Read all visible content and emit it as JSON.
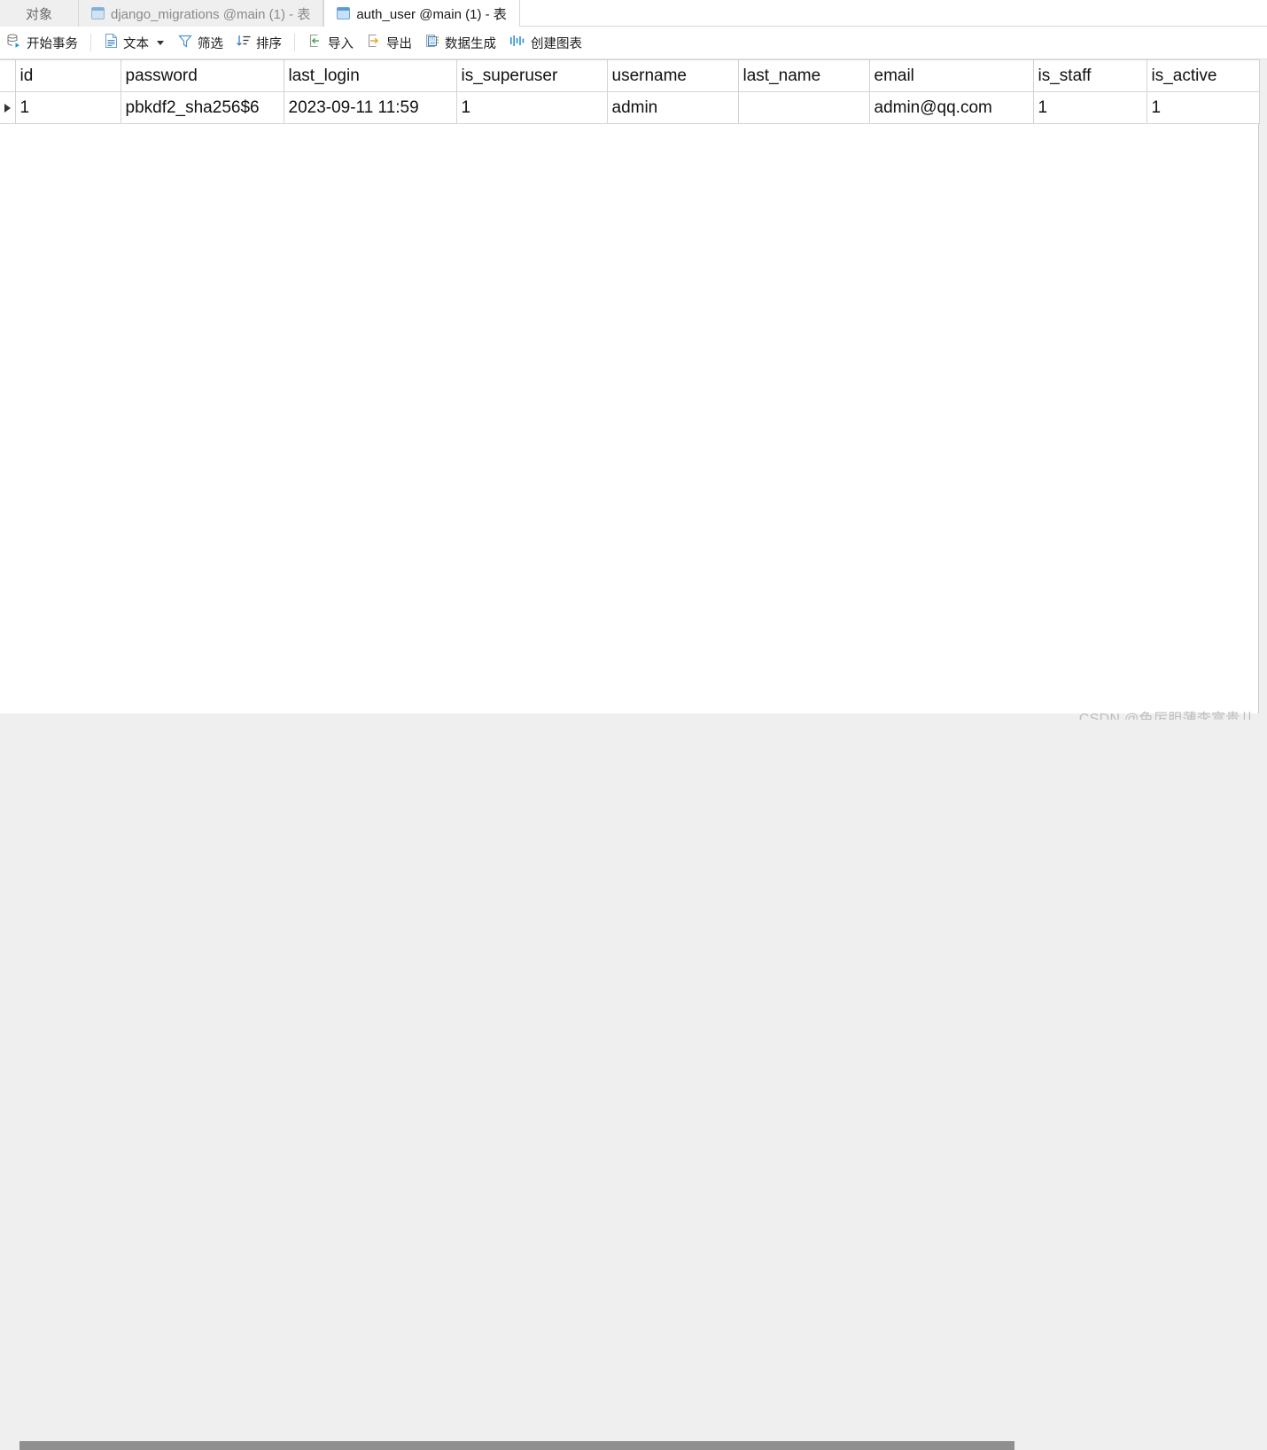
{
  "tabs": [
    {
      "label": "对象",
      "icon": null,
      "active": false,
      "kind": "objects"
    },
    {
      "label": "django_migrations @main (1) - 表",
      "icon": "table-icon",
      "active": false,
      "kind": "table"
    },
    {
      "label": "auth_user @main (1) - 表",
      "icon": "table-icon",
      "active": true,
      "kind": "table"
    }
  ],
  "toolbar": {
    "items": [
      {
        "label": "开始事务",
        "icon": "begin-transaction-icon",
        "caret": false
      },
      {
        "label": "文本",
        "icon": "text-document-icon",
        "caret": true
      },
      {
        "label": "筛选",
        "icon": "filter-funnel-icon",
        "caret": false
      },
      {
        "label": "排序",
        "icon": "sort-icon",
        "caret": false
      },
      {
        "label": "导入",
        "icon": "import-icon",
        "caret": false
      },
      {
        "label": "导出",
        "icon": "export-icon",
        "caret": false
      },
      {
        "label": "数据生成",
        "icon": "data-generation-icon",
        "caret": false
      },
      {
        "label": "创建图表",
        "icon": "create-chart-icon",
        "caret": false
      }
    ]
  },
  "grid": {
    "columns": [
      "id",
      "password",
      "last_login",
      "is_superuser",
      "username",
      "last_name",
      "email",
      "is_staff",
      "is_active"
    ],
    "selected_column": "id",
    "rows": [
      {
        "marker": "current-row-marker",
        "selected_cell": "id",
        "cells": {
          "id": "1",
          "password": "pbkdf2_sha256$6",
          "last_login": "2023-09-11 11:59",
          "is_superuser": "1",
          "username": "admin",
          "last_name": "",
          "email": "admin@qq.com",
          "is_staff": "1",
          "is_active": "1"
        }
      }
    ]
  },
  "scrollbar": {
    "orientation": "horizontal",
    "thumb_position_pct": 2,
    "thumb_width_pct": 79
  },
  "watermark": {
    "text": "CSDN @色厉胆薄李富贵儿"
  },
  "colors": {
    "selection_blue": "#0a7bd4",
    "header_selected": "#dbe9f7",
    "chrome_gray": "#efefef",
    "grid_line": "#d3d3d3"
  }
}
